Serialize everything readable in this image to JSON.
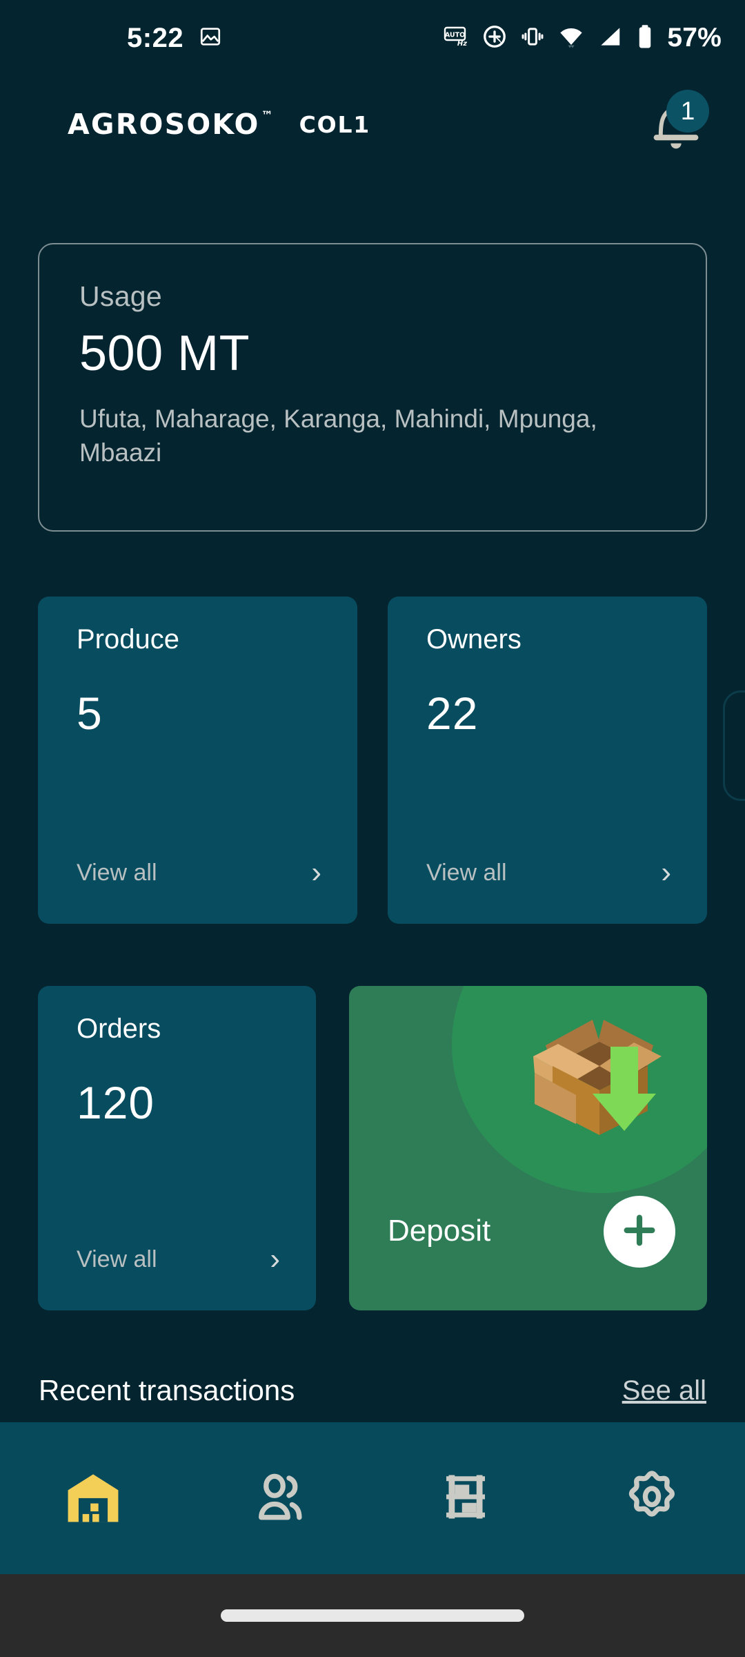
{
  "status_bar": {
    "time": "5:22",
    "battery_percent": "57%",
    "icons": [
      "screenshot-icon",
      "auto-hz-icon",
      "adaptive-brightness-icon",
      "vibrate-icon",
      "wifi-icon",
      "cellular-signal-icon",
      "battery-icon"
    ]
  },
  "header": {
    "brand": "AGROSOKO",
    "trademark": "™",
    "collection_label": "COL1",
    "notification_count": "1",
    "bell_icon": "bell-icon"
  },
  "usage_card": {
    "label": "Usage",
    "value": "500 MT",
    "produce_list": "Ufuta, Maharage, Karanga, Mahindi, Mpunga, Mbaazi"
  },
  "stat_cards": [
    {
      "title": "Produce",
      "value": "5",
      "action": "View all",
      "chevron": "chevron-right-icon"
    },
    {
      "title": "Owners",
      "value": "22",
      "action": "View all",
      "chevron": "chevron-right-icon"
    },
    {
      "title": "Orders",
      "value": "120",
      "action": "View all",
      "chevron": "chevron-right-icon"
    }
  ],
  "deposit_card": {
    "label": "Deposit",
    "fab_icon": "plus-icon",
    "art_icon": "open-box-with-down-arrow-icon"
  },
  "recent": {
    "title": "Recent transactions",
    "see_all": "See all"
  },
  "bottom_nav": [
    {
      "name": "warehouse",
      "label": "warehouse-icon",
      "active": true
    },
    {
      "name": "owners",
      "label": "people-icon",
      "active": false
    },
    {
      "name": "inventory",
      "label": "shelf-rack-icon",
      "active": false
    },
    {
      "name": "settings",
      "label": "gear-icon",
      "active": false
    }
  ],
  "colors": {
    "background": "#04242f",
    "card": "#084c5f",
    "nav_bar": "#074a5c",
    "deposit_green": "#2f7d57",
    "deposit_blob_green": "#2b9055",
    "accent_yellow": "#f4cf58",
    "muted_text": "#b9c0c2",
    "icon_grey": "#c9cbc4",
    "arrow_green": "#7ed957"
  }
}
